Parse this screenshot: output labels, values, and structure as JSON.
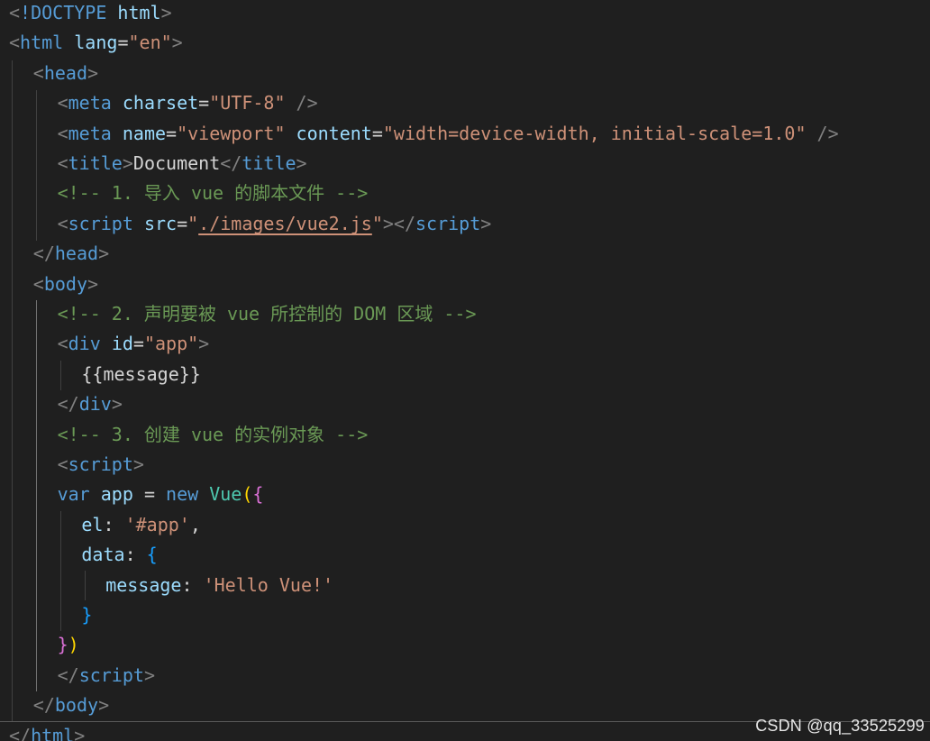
{
  "editor": {
    "language": "html",
    "lines": [
      [
        [
          "punc",
          "<"
        ],
        [
          "tag",
          "!DOCTYPE"
        ],
        [
          "txt",
          " "
        ],
        [
          "attr",
          "html"
        ],
        [
          "punc",
          ">"
        ]
      ],
      [
        [
          "punc",
          "<"
        ],
        [
          "tag",
          "html"
        ],
        [
          "txt",
          " "
        ],
        [
          "attr",
          "lang"
        ],
        [
          "txt",
          "="
        ],
        [
          "str",
          "\"en\""
        ],
        [
          "punc",
          ">"
        ]
      ],
      [
        [
          "punc",
          "<"
        ],
        [
          "tag",
          "head"
        ],
        [
          "punc",
          ">"
        ]
      ],
      [
        [
          "punc",
          "<"
        ],
        [
          "tag",
          "meta"
        ],
        [
          "txt",
          " "
        ],
        [
          "attr",
          "charset"
        ],
        [
          "txt",
          "="
        ],
        [
          "str",
          "\"UTF-8\""
        ],
        [
          "txt",
          " "
        ],
        [
          "punc",
          "/>"
        ]
      ],
      [
        [
          "punc",
          "<"
        ],
        [
          "tag",
          "meta"
        ],
        [
          "txt",
          " "
        ],
        [
          "attr",
          "name"
        ],
        [
          "txt",
          "="
        ],
        [
          "str",
          "\"viewport\""
        ],
        [
          "txt",
          " "
        ],
        [
          "attr",
          "content"
        ],
        [
          "txt",
          "="
        ],
        [
          "str",
          "\"width=device-width, initial-scale=1.0\""
        ],
        [
          "txt",
          " "
        ],
        [
          "punc",
          "/>"
        ]
      ],
      [
        [
          "punc",
          "<"
        ],
        [
          "tag",
          "title"
        ],
        [
          "punc",
          ">"
        ],
        [
          "txt",
          "Document"
        ],
        [
          "punc",
          "</"
        ],
        [
          "tag",
          "title"
        ],
        [
          "punc",
          ">"
        ]
      ],
      [
        [
          "cmt",
          "<!-- 1. 导入 vue 的脚本文件 -->"
        ]
      ],
      [
        [
          "punc",
          "<"
        ],
        [
          "tag",
          "script"
        ],
        [
          "txt",
          " "
        ],
        [
          "attr",
          "src"
        ],
        [
          "txt",
          "="
        ],
        [
          "str",
          "\""
        ],
        [
          "str link",
          "./images/vue2.js"
        ],
        [
          "str",
          "\""
        ],
        [
          "punc",
          "></"
        ],
        [
          "tag",
          "script"
        ],
        [
          "punc",
          ">"
        ]
      ],
      [
        [
          "punc",
          "</"
        ],
        [
          "tag",
          "head"
        ],
        [
          "punc",
          ">"
        ]
      ],
      [
        [
          "punc",
          "<"
        ],
        [
          "tag",
          "body"
        ],
        [
          "punc",
          ">"
        ]
      ],
      [
        [
          "cmt",
          "<!-- 2. 声明要被 vue 所控制的 DOM 区域 -->"
        ]
      ],
      [
        [
          "punc",
          "<"
        ],
        [
          "tag",
          "div"
        ],
        [
          "txt",
          " "
        ],
        [
          "attr",
          "id"
        ],
        [
          "txt",
          "="
        ],
        [
          "str",
          "\"app\""
        ],
        [
          "punc",
          ">"
        ]
      ],
      [
        [
          "txt",
          "{{message}}"
        ]
      ],
      [
        [
          "punc",
          "</"
        ],
        [
          "tag",
          "div"
        ],
        [
          "punc",
          ">"
        ]
      ],
      [
        [
          "cmt",
          "<!-- 3. 创建 vue 的实例对象 -->"
        ]
      ],
      [
        [
          "punc",
          "<"
        ],
        [
          "tag",
          "script"
        ],
        [
          "punc",
          ">"
        ]
      ],
      [
        [
          "kw",
          "var"
        ],
        [
          "txt",
          " "
        ],
        [
          "var",
          "app"
        ],
        [
          "txt",
          " "
        ],
        [
          "op",
          "="
        ],
        [
          "txt",
          " "
        ],
        [
          "kw",
          "new"
        ],
        [
          "txt",
          " "
        ],
        [
          "cls",
          "Vue"
        ],
        [
          "br1",
          "("
        ],
        [
          "br2",
          "{"
        ]
      ],
      [
        [
          "var",
          "el"
        ],
        [
          "txt",
          ": "
        ],
        [
          "str",
          "'#app'"
        ],
        [
          "txt",
          ","
        ]
      ],
      [
        [
          "var",
          "data"
        ],
        [
          "txt",
          ": "
        ],
        [
          "br3",
          "{"
        ]
      ],
      [
        [
          "var",
          "message"
        ],
        [
          "txt",
          ": "
        ],
        [
          "str",
          "'Hello Vue!'"
        ]
      ],
      [
        [
          "br3",
          "}"
        ]
      ],
      [
        [
          "br2",
          "}"
        ],
        [
          "br1",
          ")"
        ]
      ],
      [
        [
          "punc",
          "</"
        ],
        [
          "tag",
          "script"
        ],
        [
          "punc",
          ">"
        ]
      ],
      [
        [
          "punc",
          "</"
        ],
        [
          "tag",
          "body"
        ],
        [
          "punc",
          ">"
        ]
      ],
      [
        [
          "punc",
          "</"
        ],
        [
          "tag",
          "html"
        ],
        [
          "punc",
          ">"
        ]
      ]
    ]
  },
  "watermark": "CSDN @qq_33525299",
  "colors": {
    "background": "#1f1f1f",
    "tag": "#569cd6",
    "attribute": "#9cdcfe",
    "string": "#ce9178",
    "comment": "#6a9955",
    "class": "#4ec9b0",
    "bracket_gold": "#ffd700",
    "bracket_purple": "#da70d6",
    "bracket_blue": "#179fff"
  }
}
